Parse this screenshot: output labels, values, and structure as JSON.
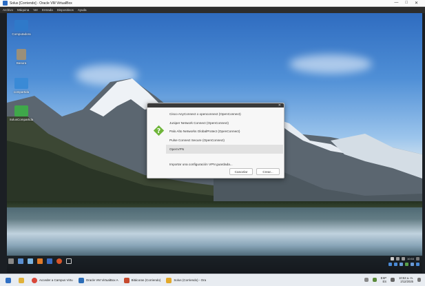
{
  "vbox": {
    "title": "Solus [Corriendo] - Oracle VM VirtualBox",
    "menu": [
      "Archivo",
      "Máquina",
      "Ver",
      "Entrada",
      "Dispositivos",
      "Ayuda"
    ],
    "controls": {
      "minimize": "—",
      "restore": "□",
      "close": "✕"
    }
  },
  "desktop": {
    "icons": [
      {
        "label": "Computadora",
        "icon": "computer-icon",
        "color": "#2f79c9"
      },
      {
        "label": "Basura",
        "icon": "trash-icon",
        "color": "#9a8f7a"
      },
      {
        "label": "compartida",
        "icon": "shared-folder-icon",
        "color": "#3a8ad6"
      },
      {
        "label": "SolusCompartida",
        "icon": "shared-folder-icon",
        "color": "#3fa84a"
      }
    ]
  },
  "dialog": {
    "options": [
      "Cisco AnyConnect o openconnect (OpenConnect)",
      "Juniper Network Connect (OpenConnect)",
      "Palo Alto Networks GlobalProtect (OpenConnect)",
      "Pulse Connect Secure (OpenConnect)",
      "OpenVPN"
    ],
    "selected_index": 4,
    "import_label": "Importar una configuración VPN guardada...",
    "cancel_label": "Cancelar",
    "create_label": "Crear...",
    "icon": "vpn-question-icon",
    "icon_color": "#6fb53a"
  },
  "guest_panel": {
    "clock": "10:53"
  },
  "host_taskbar": {
    "items": [
      {
        "label": "",
        "icon": "file-manager-icon",
        "color": "#2f6fc4"
      },
      {
        "label": "",
        "icon": "folder-icon",
        "color": "#e0b13a"
      },
      {
        "label": "Acceder a Campus Virtu",
        "icon": "chrome-icon",
        "color": "#d9473a"
      },
      {
        "label": "Oracle VM VirtualBox A",
        "icon": "virtualbox-icon",
        "color": "#2c6db7"
      },
      {
        "label": "Bitácoras (Corriendo)",
        "icon": "virtualbox-icon",
        "color": "#c64a2e"
      },
      {
        "label": "Solus (Corriendo) - Ora",
        "icon": "virtualbox-icon",
        "color": "#e2a82a"
      }
    ],
    "lang": "ESP",
    "lang_sub": "ES",
    "time": "10:53 a. m.",
    "date": "2/12/2025"
  }
}
